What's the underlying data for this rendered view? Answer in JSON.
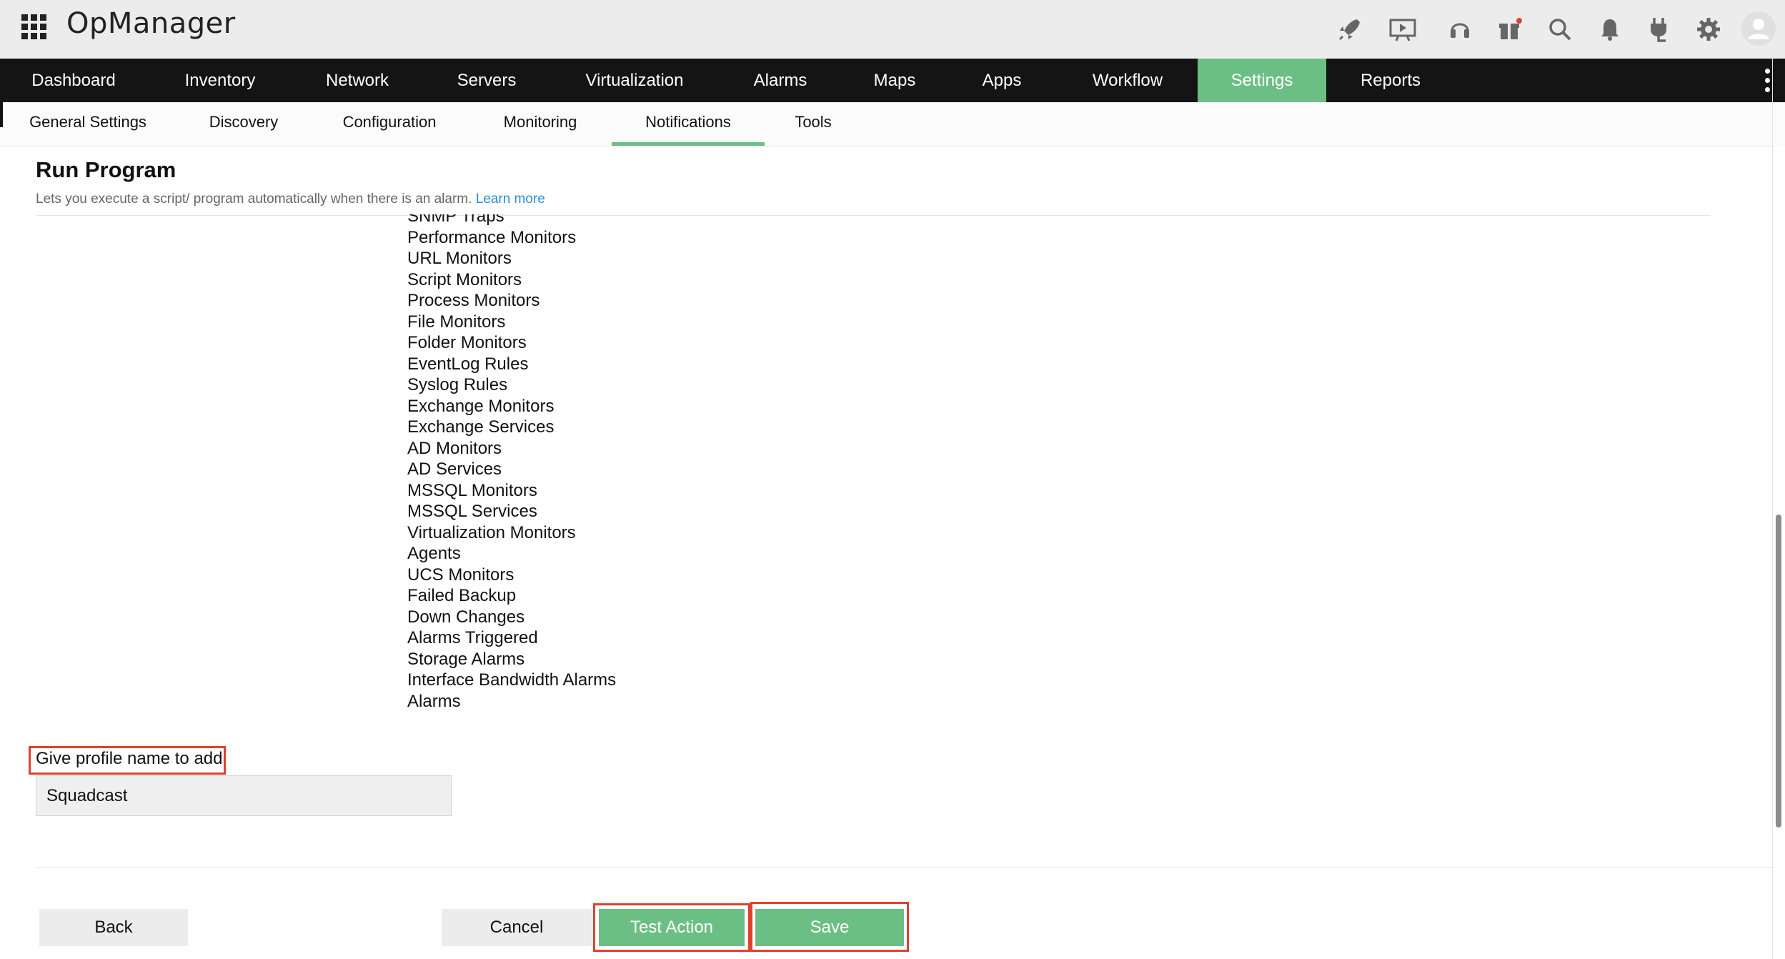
{
  "app": {
    "name": "OpManager"
  },
  "top_icons": [
    "rocket-icon",
    "presentation-icon",
    "headset-icon",
    "gift-icon",
    "search-icon",
    "bell-icon",
    "plug-icon",
    "gear-icon",
    "avatar-icon"
  ],
  "colors": {
    "accent": "#6cbf84",
    "highlight": "#e0412e",
    "link": "#2a8cd8",
    "navbar": "#141414"
  },
  "mainnav": {
    "items": [
      "Dashboard",
      "Inventory",
      "Network",
      "Servers",
      "Virtualization",
      "Alarms",
      "Maps",
      "Apps",
      "Workflow",
      "Settings",
      "Reports"
    ],
    "active": "Settings"
  },
  "subnav": {
    "items": [
      "General Settings",
      "Discovery",
      "Configuration",
      "Monitoring",
      "Notifications",
      "Tools"
    ],
    "active": "Notifications"
  },
  "page": {
    "title": "Run Program",
    "description": "Lets you execute a script/ program automatically when there is an alarm.",
    "learn_more": "Learn more"
  },
  "events": [
    "SNMP Traps",
    "Performance Monitors",
    "URL Monitors",
    "Script Monitors",
    "Process Monitors",
    "File Monitors",
    "Folder Monitors",
    "EventLog Rules",
    "Syslog Rules",
    "Exchange Monitors",
    "Exchange Services",
    "AD Monitors",
    "AD Services",
    "MSSQL Monitors",
    "MSSQL Services",
    "Virtualization Monitors",
    "Agents",
    "UCS Monitors",
    "Failed Backup",
    "Down Changes",
    "Alarms Triggered",
    "Storage Alarms",
    "Interface Bandwidth Alarms",
    "Alarms"
  ],
  "profile": {
    "label": "Give profile name to add",
    "value": "Squadcast"
  },
  "buttons": {
    "back": "Back",
    "cancel": "Cancel",
    "test_action": "Test Action",
    "save": "Save"
  }
}
